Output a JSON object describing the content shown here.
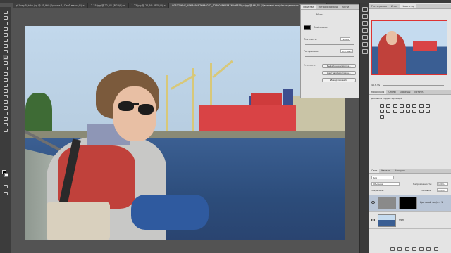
{
  "document_tabs": [
    "q01nsg-5_bNw.jpg @ 45,9% (Кривые 1, Слой-маска/8) ×",
    "2-35.jpg @ 22,5% (RGB/8) ×",
    "1-23.jpg @ 22,5% (RGB/8) ×",
    "9067726HE_4063498976940272_5268088625476546819_n.jpg @ 46,7% (Цветовой тон/Насыщенность 1, Слой-маска/8) ×"
  ],
  "properties_panel": {
    "tabs": [
      "Свойства",
      "История команд",
      "Кисти"
    ],
    "section_title": "Маска",
    "mask_label": "Слой-маска",
    "density_label": "Плотность:",
    "density_value": "100%",
    "feather_label": "Растушевка:",
    "feather_value": "0,0 пикс",
    "refine_label": "Уточнить:",
    "buttons": [
      "Выделение и маска...",
      "Цветовой диапазон...",
      "Инвертировать"
    ]
  },
  "navigator_panel": {
    "tabs": [
      "Гистограмма",
      "Инфо",
      "Навигатор"
    ],
    "zoom_value": "46,67%"
  },
  "adjustments_panel": {
    "tabs": [
      "Коррекция",
      "Стили",
      "Образцы",
      "Источн."
    ],
    "title": "Добавить корректирующий"
  },
  "layers_panel": {
    "tabs": [
      "Слои",
      "Каналы",
      "Контуры"
    ],
    "filter_label": "Вид",
    "blend_mode": "Обычные",
    "opacity_label": "Непрозрачность:",
    "opacity_value": "100%",
    "lock_label": "Закрепить:",
    "fill_label": "Заливка:",
    "fill_value": "100%",
    "layers": [
      {
        "name": "Цветовой тон/н... 1",
        "selected": true
      },
      {
        "name": "Фон",
        "selected": false
      }
    ]
  },
  "colors": {
    "accent": "#d94345",
    "ui_dark": "#3c3c3c",
    "panel_light": "#e4e4e4"
  }
}
